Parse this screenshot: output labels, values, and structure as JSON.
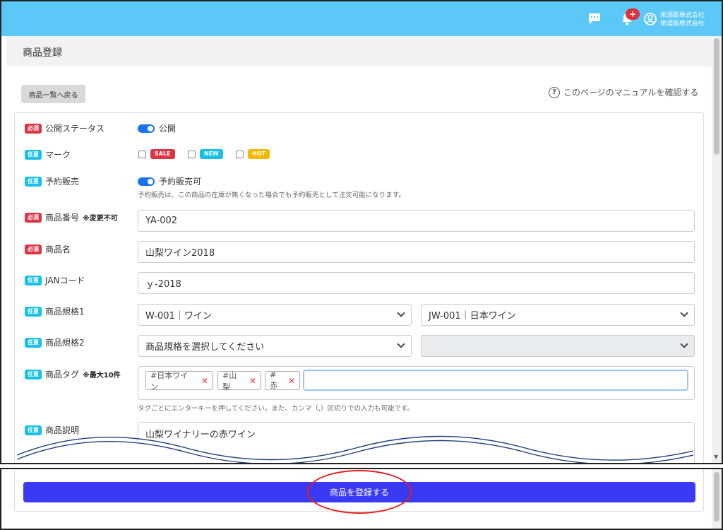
{
  "header": {
    "company_line1": "栄酒販株式会社",
    "company_line2": "栄酒販株式会社",
    "notification_badge": "+",
    "bg_color": "#5bc8f7"
  },
  "page": {
    "title": "商品登録",
    "back_button": "商品一覧へ戻る",
    "manual_link": "このページのマニュアルを確認する"
  },
  "badges": {
    "required": "必須",
    "optional": "任意"
  },
  "form": {
    "status": {
      "label": "公開ステータス",
      "value": "公開"
    },
    "mark": {
      "label": "マーク",
      "options": [
        "SALE",
        "NEW",
        "HOT"
      ]
    },
    "preorder": {
      "label": "予約販売",
      "value": "予約販売可",
      "help": "予約販売は、この商品の在庫が無くなった場合でも予約販売として注文可能になります。"
    },
    "product_code": {
      "label": "商品番号",
      "note": "※変更不可",
      "value": "YA-002"
    },
    "product_name": {
      "label": "商品名",
      "value": "山梨ワイン2018"
    },
    "jan_code": {
      "label": "JANコード",
      "value": "ｙ-2018"
    },
    "spec1": {
      "label": "商品規格1",
      "select1": "W-001｜ワイン",
      "select2": "JW-001｜日本ワイン"
    },
    "spec2": {
      "label": "商品規格2",
      "select1": "商品規格を選択してください",
      "select2": ""
    },
    "tags": {
      "label": "商品タグ",
      "note": "※最大10件",
      "items": [
        "#日本ワイン",
        "#山梨",
        "#赤"
      ],
      "help": "タグごとにエンターキーを押してください。また、カンマ（,）区切りでの入力も可能です。"
    },
    "description": {
      "label": "商品説明",
      "value": "山梨ワイナリーの赤ワイン"
    }
  },
  "footer": {
    "submit": "商品を登録する"
  },
  "colors": {
    "required": "#dc3545",
    "optional": "#17c0e8",
    "hot": "#f5b800",
    "submit": "#3a3af5",
    "toggle": "#1a73e8"
  },
  "icons": [
    "chat-icon",
    "bell-icon",
    "user-icon",
    "help-icon",
    "chevron-down-icon",
    "close-icon"
  ]
}
